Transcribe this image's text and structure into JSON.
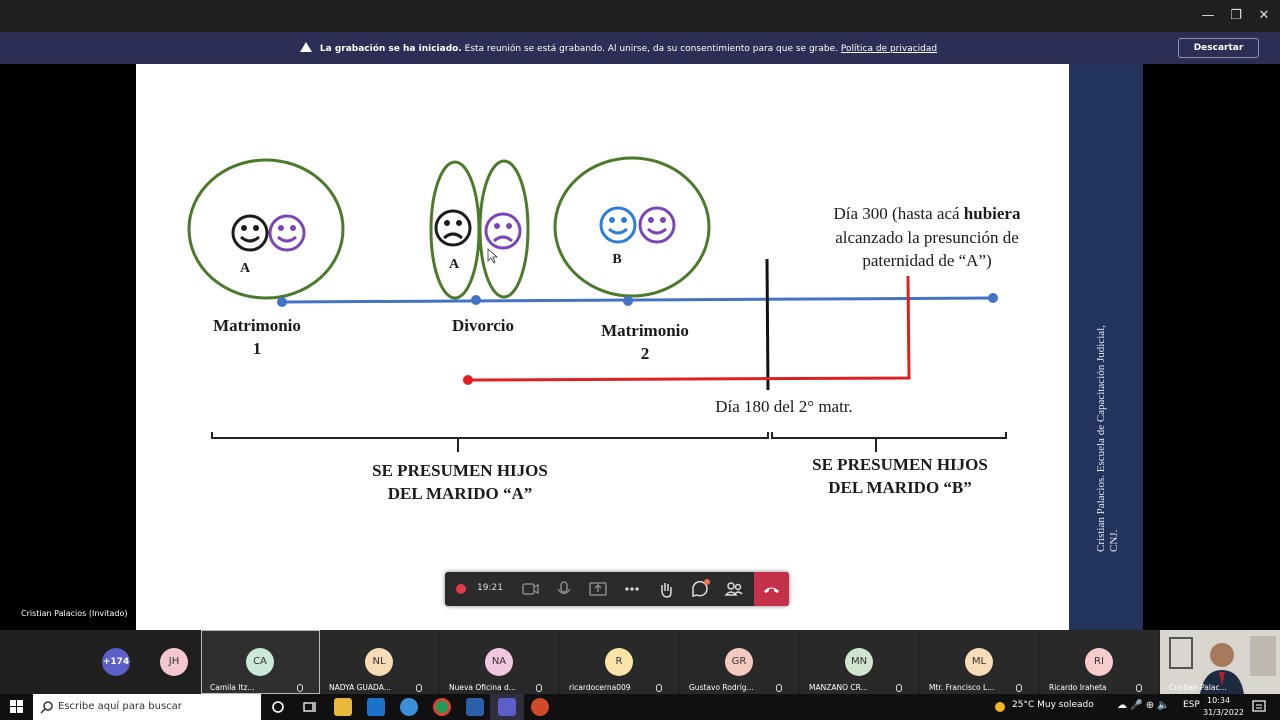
{
  "window": {
    "minimize": "—",
    "restore": "❐",
    "close": "✕"
  },
  "banner": {
    "title": "La grabación se ha iniciado.",
    "message": "Esta reunión se está grabando. Al unirse, da su consentimiento para que se grabe.",
    "link": "Política de privacidad",
    "dismiss_label": "Descartar"
  },
  "slide": {
    "label_a1": "A",
    "label_a2": "A",
    "label_b": "B",
    "matrimonio1_line1": "Matrimonio",
    "matrimonio1_line2": "1",
    "divorcio": "Divorcio",
    "matrimonio2_line1": "Matrimonio",
    "matrimonio2_line2": "2",
    "dia300_pre": "Día 300 (hasta acá ",
    "dia300_bold": "hubiera",
    "dia300_line2": "alcanzado la presunción de",
    "dia300_line3": "paternidad de “A”)",
    "dia180": "Día 180 del 2° matr.",
    "presumen_a_line1": "SE PRESUMEN HIJOS",
    "presumen_a_line2": "DEL MARIDO “A”",
    "presumen_b_line1": "SE PRESUMEN HIJOS",
    "presumen_b_line2": "DEL MARIDO “B”",
    "side_text_line1": "Cristian Palacios. Escuela de Capacitación Judicial,",
    "side_text_line2": "CNJ."
  },
  "presenter_label": "Cristian Palacios (Invitado)",
  "controls": {
    "timer": "19:21"
  },
  "participants": [
    {
      "initials": "+174",
      "name": "",
      "color": "#5b5fc7"
    },
    {
      "initials": "JH",
      "name": "",
      "color": "#f4c6d0"
    },
    {
      "initials": "CA",
      "name": "Camila Itz...",
      "color": "#c8e9d8"
    },
    {
      "initials": "NL",
      "name": "NADYA GUADA...",
      "color": "#f7dcb7"
    },
    {
      "initials": "NA",
      "name": "Nueva Oficina d...",
      "color": "#f1c7e0"
    },
    {
      "initials": "R",
      "name": "ricardocerna009",
      "color": "#fbe3a9"
    },
    {
      "initials": "GR",
      "name": "Gustavo Rodríg...",
      "color": "#f4c9c0"
    },
    {
      "initials": "MN",
      "name": "MANZANO CR...",
      "color": "#cfe5cf"
    },
    {
      "initials": "ML",
      "name": "Mtr. Francisco L...",
      "color": "#f7dcb7"
    },
    {
      "initials": "RI",
      "name": "Ricardo Iraheta",
      "color": "#f6cccc"
    }
  ],
  "self_view_name": "Cristian Palac...",
  "taskbar": {
    "search_placeholder": "Escribe aquí para buscar",
    "weather": "25°C  Muy soleado",
    "lang": "ESP",
    "time": "10:34",
    "date": "31/3/2022"
  },
  "colors": {
    "banner": "#2d2e55",
    "timeline_blue": "#4472c4",
    "red_line": "#e02020",
    "circle_green": "#4a7a2a",
    "purple_face": "#7b45b8",
    "blue_face": "#2b7fd4",
    "hangup": "#c4314b"
  }
}
